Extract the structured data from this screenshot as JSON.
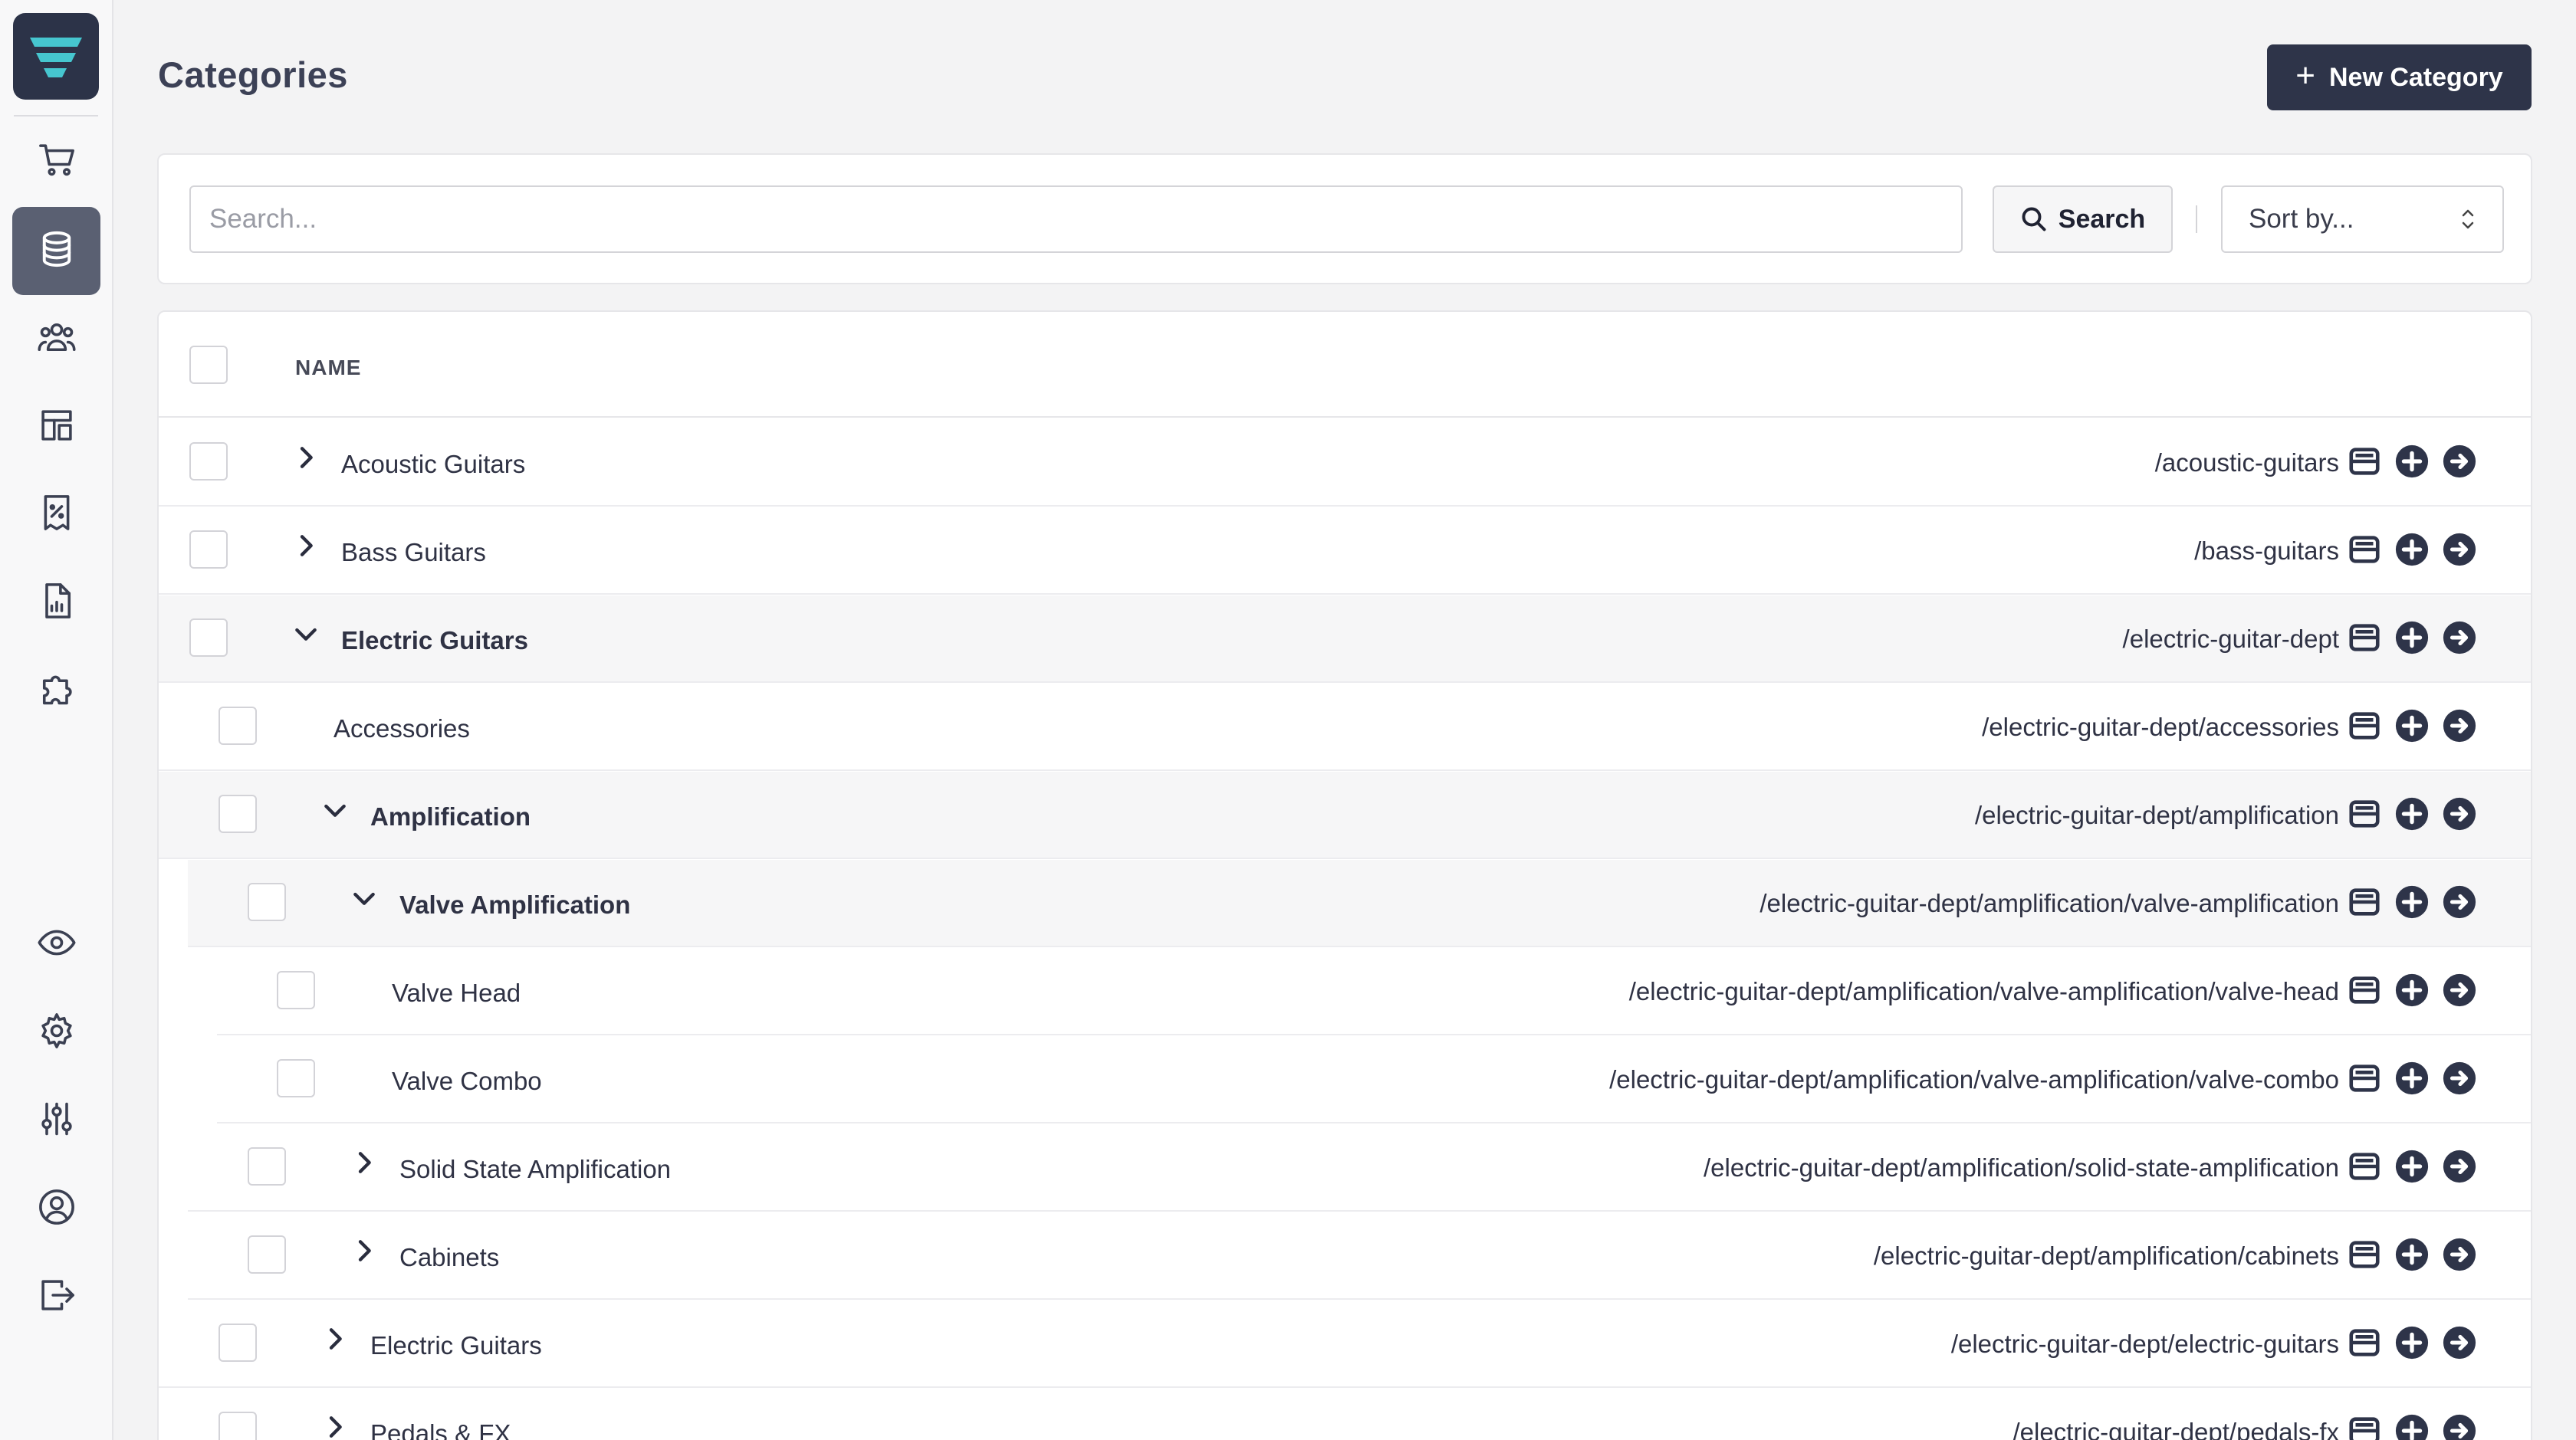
{
  "page": {
    "title": "Categories",
    "new_button_label": "New Category"
  },
  "sidebar": {
    "items": [
      {
        "icon": "cart-icon",
        "active": false
      },
      {
        "icon": "database-icon",
        "active": true
      },
      {
        "icon": "users-icon",
        "active": false
      },
      {
        "icon": "layout-icon",
        "active": false
      },
      {
        "icon": "receipt-percent-icon",
        "active": false
      },
      {
        "icon": "report-icon",
        "active": false
      },
      {
        "icon": "puzzle-icon",
        "active": false
      },
      {
        "icon": "eye-icon",
        "active": false
      },
      {
        "icon": "gear-icon",
        "active": false
      },
      {
        "icon": "sliders-icon",
        "active": false
      },
      {
        "icon": "user-circle-icon",
        "active": false
      },
      {
        "icon": "logout-icon",
        "active": false
      }
    ]
  },
  "search": {
    "placeholder": "Search...",
    "button_label": "Search",
    "sort_placeholder": "Sort by..."
  },
  "table": {
    "header_name": "NAME",
    "rows": [
      {
        "name": "Acoustic Guitars",
        "slug": "/acoustic-guitars",
        "level": 0,
        "expander": "collapsed",
        "bold": false,
        "shaded": false
      },
      {
        "name": "Bass Guitars",
        "slug": "/bass-guitars",
        "level": 0,
        "expander": "collapsed",
        "bold": false,
        "shaded": false
      },
      {
        "name": "Electric Guitars",
        "slug": "/electric-guitar-dept",
        "level": 0,
        "expander": "expanded",
        "bold": true,
        "shaded": true
      },
      {
        "name": "Accessories",
        "slug": "/electric-guitar-dept/accessories",
        "level": 1,
        "expander": "none",
        "bold": false,
        "shaded": false
      },
      {
        "name": "Amplification",
        "slug": "/electric-guitar-dept/amplification",
        "level": 1,
        "expander": "expanded",
        "bold": true,
        "shaded": true
      },
      {
        "name": "Valve Amplification",
        "slug": "/electric-guitar-dept/amplification/valve-amplification",
        "level": 2,
        "expander": "expanded",
        "bold": true,
        "shaded": true
      },
      {
        "name": "Valve Head",
        "slug": "/electric-guitar-dept/amplification/valve-amplification/valve-head",
        "level": 3,
        "expander": "none",
        "bold": false,
        "shaded": false
      },
      {
        "name": "Valve Combo",
        "slug": "/electric-guitar-dept/amplification/valve-amplification/valve-combo",
        "level": 3,
        "expander": "none",
        "bold": false,
        "shaded": false
      },
      {
        "name": "Solid State Amplification",
        "slug": "/electric-guitar-dept/amplification/solid-state-amplification",
        "level": 2,
        "expander": "collapsed",
        "bold": false,
        "shaded": false
      },
      {
        "name": "Cabinets",
        "slug": "/electric-guitar-dept/amplification/cabinets",
        "level": 2,
        "expander": "collapsed",
        "bold": false,
        "shaded": false
      },
      {
        "name": "Electric Guitars",
        "slug": "/electric-guitar-dept/electric-guitars",
        "level": 1,
        "expander": "collapsed",
        "bold": false,
        "shaded": false
      },
      {
        "name": "Pedals & FX",
        "slug": "/electric-guitar-dept/pedals-fx",
        "level": 1,
        "expander": "collapsed",
        "bold": false,
        "shaded": false
      }
    ],
    "row_action_icons": [
      "archive-icon",
      "add-child-icon",
      "open-arrow-icon"
    ]
  },
  "colors": {
    "brand": "#2c3348",
    "logo_accent": "#3fc1c9",
    "sidebar_active": "#5a6072"
  }
}
